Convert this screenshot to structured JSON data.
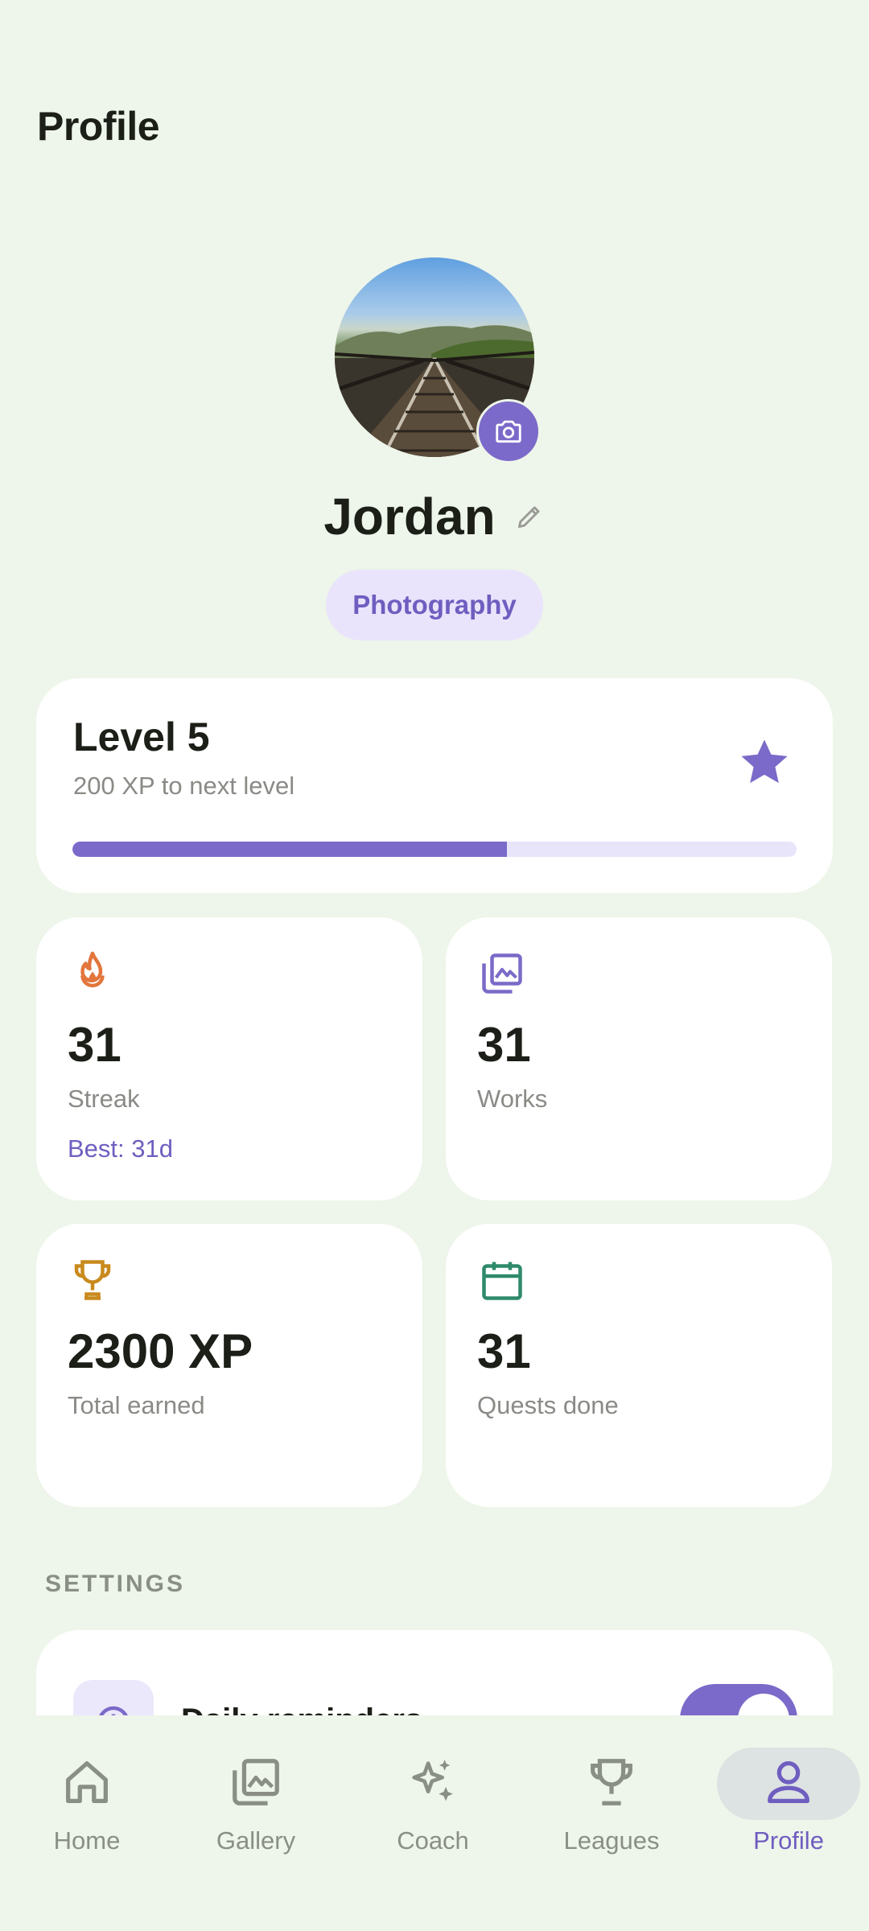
{
  "header": {
    "title": "Profile"
  },
  "profile": {
    "name": "Jordan",
    "category": "Photography"
  },
  "level": {
    "title": "Level 5",
    "subtitle": "200 XP to next level",
    "progress_fraction": 0.6
  },
  "stats": [
    {
      "value": "31",
      "label": "Streak",
      "extra": "Best: 31d",
      "icon": "flame-icon",
      "color": "#e2763c"
    },
    {
      "value": "31",
      "label": "Works",
      "icon": "gallery-icon",
      "color": "#7b6ac9"
    },
    {
      "value": "2300 XP",
      "label": "Total earned",
      "icon": "trophy-icon",
      "color": "#c98a1d"
    },
    {
      "value": "31",
      "label": "Quests done",
      "icon": "calendar-icon",
      "color": "#2e8a6a"
    }
  ],
  "settings": {
    "section_label": "SETTINGS",
    "items": [
      {
        "label": "Daily reminders",
        "enabled": true
      }
    ]
  },
  "nav": {
    "items": [
      {
        "label": "Home",
        "icon": "home-icon"
      },
      {
        "label": "Gallery",
        "icon": "gallery-icon"
      },
      {
        "label": "Coach",
        "icon": "sparkle-icon"
      },
      {
        "label": "Leagues",
        "icon": "trophy-icon"
      },
      {
        "label": "Profile",
        "icon": "person-icon",
        "active": true
      }
    ]
  },
  "colors": {
    "accent": "#7b6ac9",
    "background": "#eef5ea",
    "card": "#ffffff"
  }
}
